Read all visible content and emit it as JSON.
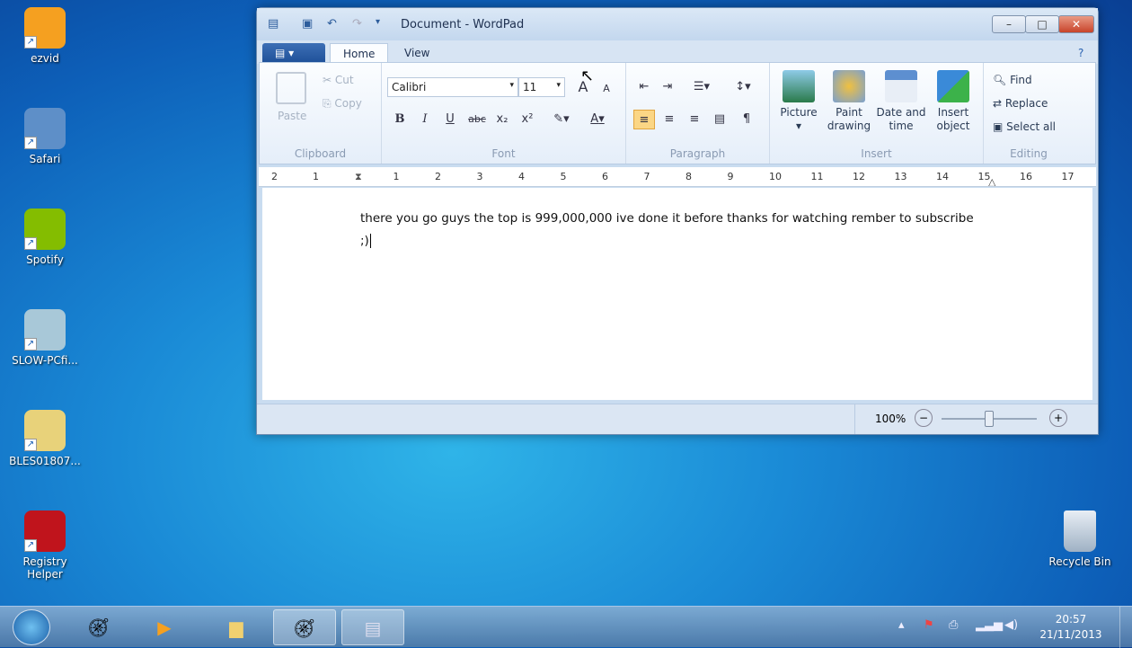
{
  "desktop": {
    "icons": [
      {
        "label": "ezvid",
        "color": "#f5a020"
      },
      {
        "label": "Safari",
        "color": "#5e8fc8"
      },
      {
        "label": "Spotify",
        "color": "#84bd00"
      },
      {
        "label": "SLOW-PCfi...",
        "color": "#a8c8d8"
      },
      {
        "label": "BLES01807...",
        "color": "#e8d27a"
      },
      {
        "label": "Registry Helper",
        "color": "#c0141c"
      }
    ],
    "recycle_bin": "Recycle Bin"
  },
  "window": {
    "title": "Document - WordPad",
    "minimize": "–",
    "maximize": "□",
    "close": "✕"
  },
  "ribbon": {
    "tabs": [
      "Home",
      "View"
    ],
    "active_tab": "Home",
    "clipboard": {
      "label": "Clipboard",
      "paste": "Paste",
      "cut": "Cut",
      "copy": "Copy"
    },
    "font": {
      "label": "Font",
      "family": "Calibri",
      "size": "11",
      "bold": "B",
      "italic": "I",
      "underline": "U",
      "strike": "abc",
      "subscript": "x₂",
      "superscript": "x²",
      "grow": "A",
      "shrink": "A",
      "color": "A"
    },
    "paragraph": {
      "label": "Paragraph"
    },
    "insert": {
      "label": "Insert",
      "picture": "Picture",
      "paint": "Paint drawing",
      "datetime": "Date and time",
      "object": "Insert object"
    },
    "editing": {
      "label": "Editing",
      "find": "Find",
      "replace": "Replace",
      "select_all": "Select all"
    }
  },
  "ruler": [
    "2",
    "1",
    "1",
    "2",
    "3",
    "4",
    "5",
    "6",
    "7",
    "8",
    "9",
    "10",
    "11",
    "12",
    "13",
    "14",
    "15",
    "16",
    "17"
  ],
  "document": {
    "text": "there you go guys the top is 999,000,000 ive done it before thanks for watching rember to subscribe ;)"
  },
  "status": {
    "zoom": "100%",
    "zoom_fraction": 0.5
  },
  "taskbar": {
    "time": "20:57",
    "date": "21/11/2013"
  }
}
